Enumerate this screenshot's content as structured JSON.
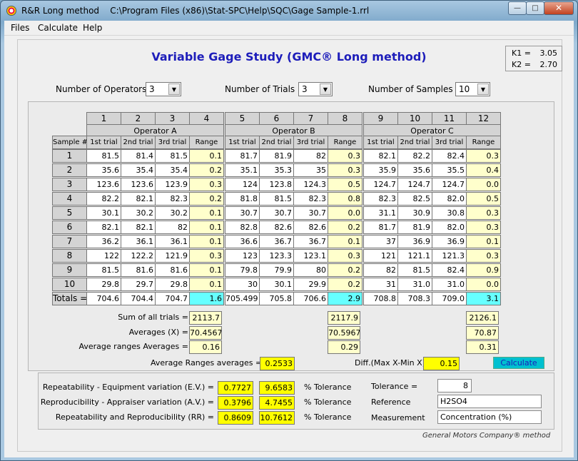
{
  "window": {
    "title": "R&R Long method    C:\\Program Files (x86)\\Stat-SPC\\Help\\SQC\\Gage Sample-1.rrl",
    "min": "—",
    "max": "□",
    "close": "✕"
  },
  "menu": {
    "files": "Files",
    "calculate": "Calculate",
    "help": "Help"
  },
  "main_title": "Variable Gage Study (GMC® Long method)",
  "k": {
    "k1_label": "K1 =",
    "k1": "3.05",
    "k2_label": "K2 =",
    "k2": "2.70"
  },
  "settings": {
    "operators_label": "Number of Operators",
    "operators": "3",
    "trials_label": "Number of Trials",
    "trials": "3",
    "samples_label": "Number of Samples",
    "samples": "10"
  },
  "columns": [
    "1",
    "2",
    "3",
    "4",
    "5",
    "6",
    "7",
    "8",
    "9",
    "10",
    "11",
    "12"
  ],
  "operators": [
    "Operator A",
    "Operator B",
    "Operator C"
  ],
  "sub_headers": [
    "1st trial",
    "2nd trial",
    "3rd trial",
    "Range"
  ],
  "sample_header": "Sample #",
  "rows": [
    {
      "n": "1",
      "v": [
        "81.5",
        "81.4",
        "81.5",
        "0.1",
        "81.7",
        "81.9",
        "82",
        "0.3",
        "82.1",
        "82.2",
        "82.4",
        "0.3"
      ]
    },
    {
      "n": "2",
      "v": [
        "35.6",
        "35.4",
        "35.4",
        "0.2",
        "35.1",
        "35.3",
        "35",
        "0.3",
        "35.9",
        "35.6",
        "35.5",
        "0.4"
      ]
    },
    {
      "n": "3",
      "v": [
        "123.6",
        "123.6",
        "123.9",
        "0.3",
        "124",
        "123.8",
        "124.3",
        "0.5",
        "124.7",
        "124.7",
        "124.7",
        "0.0"
      ]
    },
    {
      "n": "4",
      "v": [
        "82.2",
        "82.1",
        "82.3",
        "0.2",
        "81.8",
        "81.5",
        "82.3",
        "0.8",
        "82.3",
        "82.5",
        "82.0",
        "0.5"
      ]
    },
    {
      "n": "5",
      "v": [
        "30.1",
        "30.2",
        "30.2",
        "0.1",
        "30.7",
        "30.7",
        "30.7",
        "0.0",
        "31.1",
        "30.9",
        "30.8",
        "0.3"
      ]
    },
    {
      "n": "6",
      "v": [
        "82.1",
        "82.1",
        "82",
        "0.1",
        "82.8",
        "82.6",
        "82.6",
        "0.2",
        "81.7",
        "81.9",
        "82.0",
        "0.3"
      ]
    },
    {
      "n": "7",
      "v": [
        "36.2",
        "36.1",
        "36.1",
        "0.1",
        "36.6",
        "36.7",
        "36.7",
        "0.1",
        "37",
        "36.9",
        "36.9",
        "0.1"
      ]
    },
    {
      "n": "8",
      "v": [
        "122",
        "122.2",
        "121.9",
        "0.3",
        "123",
        "123.3",
        "123.1",
        "0.3",
        "121",
        "121.1",
        "121.3",
        "0.3"
      ]
    },
    {
      "n": "9",
      "v": [
        "81.5",
        "81.6",
        "81.6",
        "0.1",
        "79.8",
        "79.9",
        "80",
        "0.2",
        "82",
        "81.5",
        "82.4",
        "0.9"
      ]
    },
    {
      "n": "10",
      "v": [
        "29.8",
        "29.7",
        "29.8",
        "0.1",
        "30",
        "30.1",
        "29.9",
        "0.2",
        "31",
        "31.0",
        "31.0",
        "0.0"
      ]
    }
  ],
  "totals": {
    "label": "Totals =",
    "v": [
      "704.6",
      "704.4",
      "704.7",
      "1.6",
      "705.499",
      "705.8",
      "706.6",
      "2.9",
      "708.8",
      "708.3",
      "709.0",
      "3.1"
    ]
  },
  "summary": {
    "sum_label": "Sum of all trials =",
    "sum": [
      "2113.7",
      "2117.9",
      "2126.1"
    ],
    "avg_label": "Averages (X) =",
    "avg": [
      "70.4567",
      "70.5967",
      "70.87"
    ],
    "avgrange_label": "Average ranges Averages =",
    "avgrange": [
      "0.16",
      "0.29",
      "0.31"
    ],
    "ara_label": "Average Ranges averages =",
    "ara": "0.2533",
    "diff_label": "Diff.(Max X-Min X) =",
    "diff": "0.15",
    "calc_button": "Calculate"
  },
  "results": {
    "ev_label": "Repeatability - Equipment variation (E.V.) =",
    "ev": "0.7727",
    "ev_pct": "9.6583",
    "av_label": "Reproducibility - Appraiser variation (A.V.) =",
    "av": "0.3796",
    "av_pct": "4.7455",
    "rr_label": "Repeatability and Reproducibility (RR) =",
    "rr": "0.8609",
    "rr_pct": "10.7612",
    "pct_tol": "% Tolerance",
    "tolerance_label": "Tolerance =",
    "tolerance": "8",
    "reference_label": "Reference",
    "reference": "H2SO4",
    "measurement_label": "Measurement",
    "measurement": "Concentration (%)"
  },
  "footer": "General Motors Company® method"
}
